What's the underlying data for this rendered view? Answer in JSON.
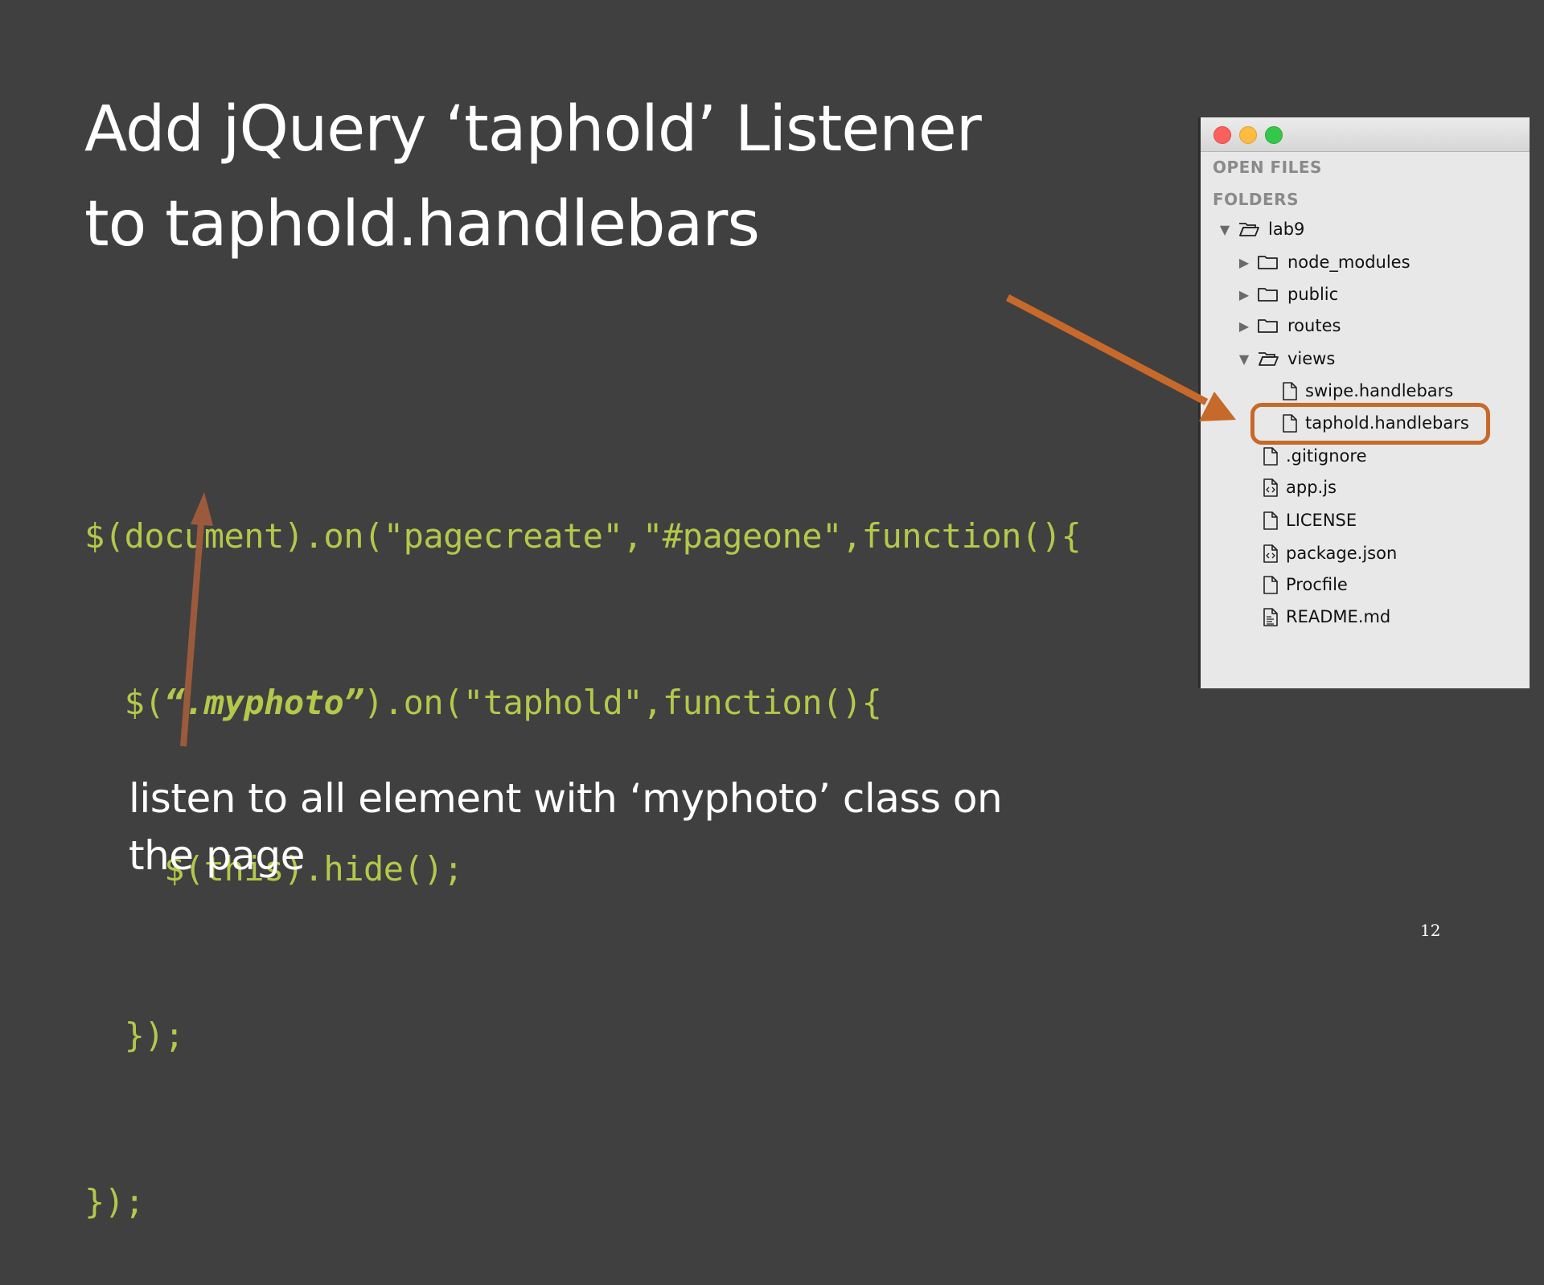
{
  "slide": {
    "title_lines": [
      "Add jQuery ‘taphold’ Listener",
      "to taphold.handlebars"
    ],
    "code": {
      "line1": "$(document).on(\"pagecreate\",\"#pageone\",function(){",
      "line2_pre": "  $(",
      "line2_em": "“.myphoto”",
      "line2_post": ").on(\"taphold\",function(){",
      "line3": "    $(this).hide();",
      "line4": "  });",
      "line5": "});"
    },
    "caption_lines": [
      "listen to all element with ‘myphoto’ class on",
      "the page"
    ],
    "page_number": "12"
  },
  "sidebar": {
    "sections": {
      "open_files": "OPEN FILES",
      "folders": "FOLDERS"
    },
    "tree": [
      {
        "label": "lab9",
        "type": "folder-open",
        "expanded": true
      },
      {
        "label": "node_modules",
        "type": "folder",
        "expanded": false
      },
      {
        "label": "public",
        "type": "folder",
        "expanded": false
      },
      {
        "label": "routes",
        "type": "folder",
        "expanded": false
      },
      {
        "label": "views",
        "type": "folder-open",
        "expanded": true
      },
      {
        "label": "swipe.handlebars",
        "type": "file"
      },
      {
        "label": "taphold.handlebars",
        "type": "file",
        "highlighted": true
      },
      {
        "label": ".gitignore",
        "type": "file"
      },
      {
        "label": "app.js",
        "type": "file-code"
      },
      {
        "label": "LICENSE",
        "type": "file"
      },
      {
        "label": "package.json",
        "type": "file-code"
      },
      {
        "label": "Procfile",
        "type": "file"
      },
      {
        "label": "README.md",
        "type": "file-text"
      }
    ]
  },
  "colors": {
    "background": "#404040",
    "code": "#b4c84a",
    "arrow": "#c7692a",
    "arrow_up": "#9c5a3c"
  }
}
